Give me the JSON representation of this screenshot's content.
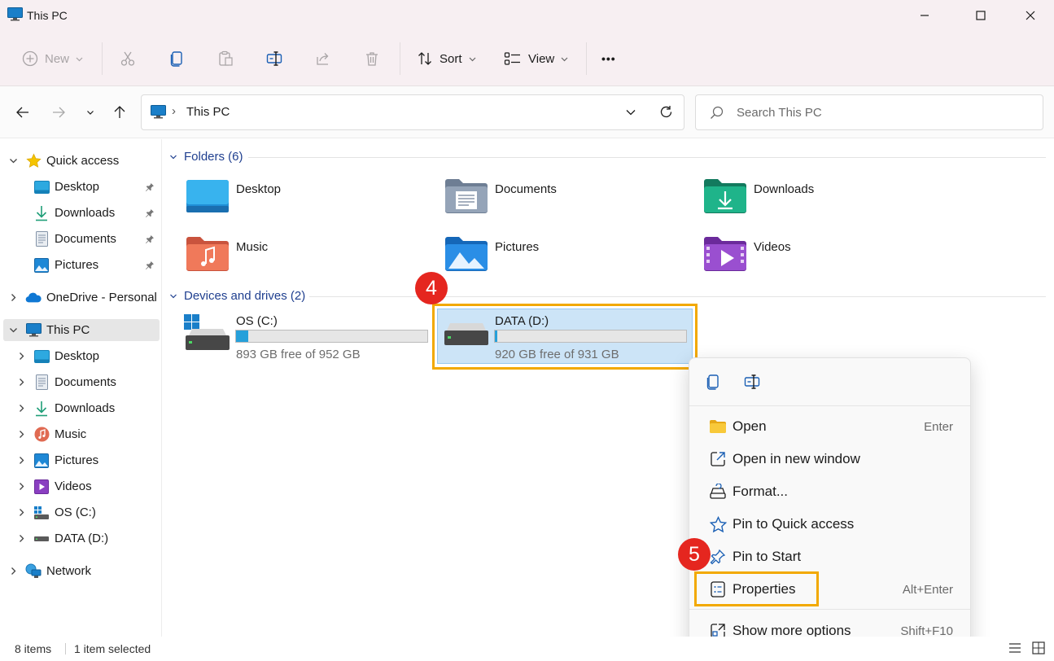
{
  "window": {
    "title": "This PC"
  },
  "toolbar": {
    "new_label": "New",
    "sort_label": "Sort",
    "view_label": "View",
    "more_label": "•••"
  },
  "address": {
    "path": "This PC",
    "separator": "›"
  },
  "search": {
    "placeholder": "Search This PC"
  },
  "nav": {
    "quick_access": "Quick access",
    "quick_items": [
      "Desktop",
      "Downloads",
      "Documents",
      "Pictures"
    ],
    "onedrive": "OneDrive - Personal",
    "this_pc": "This PC",
    "pc_items": [
      "Desktop",
      "Documents",
      "Downloads",
      "Music",
      "Pictures",
      "Videos",
      "OS (C:)",
      "DATA (D:)"
    ],
    "network": "Network"
  },
  "content": {
    "folders_header": "Folders (6)",
    "folders": [
      "Desktop",
      "Documents",
      "Downloads",
      "Music",
      "Pictures",
      "Videos"
    ],
    "drives_header": "Devices and drives (2)",
    "drives": [
      {
        "name": "OS (C:)",
        "free_text": "893 GB free of 952 GB",
        "used_fraction": 0.062
      },
      {
        "name": "DATA (D:)",
        "free_text": "920 GB free of 931 GB",
        "used_fraction": 0.012
      }
    ]
  },
  "context_menu": {
    "items": [
      {
        "label": "Open",
        "shortcut": "Enter",
        "icon": "folder-icon"
      },
      {
        "label": "Open in new window",
        "shortcut": "",
        "icon": "open-new-window-icon"
      },
      {
        "label": "Format...",
        "shortcut": "",
        "icon": "format-icon"
      },
      {
        "label": "Pin to Quick access",
        "shortcut": "",
        "icon": "star-icon"
      },
      {
        "label": "Pin to Start",
        "shortcut": "",
        "icon": "pin-icon"
      },
      {
        "label": "Properties",
        "shortcut": "Alt+Enter",
        "icon": "properties-icon"
      },
      {
        "label": "Show more options",
        "shortcut": "Shift+F10",
        "icon": "more-options-icon"
      }
    ]
  },
  "annotations": {
    "step4": "4",
    "step5": "5",
    "highlight_color": "#f2a900",
    "badge_color": "#e5261f"
  },
  "status": {
    "items": "8 items",
    "selected": "1 item selected"
  }
}
